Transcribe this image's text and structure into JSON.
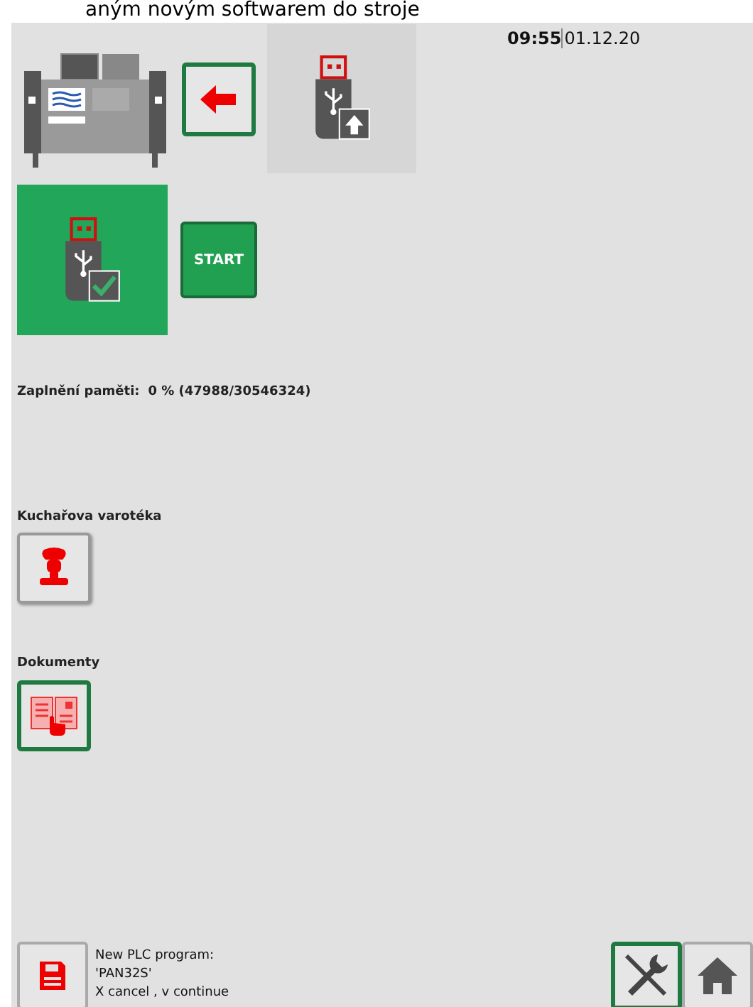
{
  "banner": "aným novým softwarem do stroje",
  "clock": {
    "time": "09:55",
    "date": "01.12.20"
  },
  "start_button": "START",
  "memory": {
    "label": "Zaplnění paměti:",
    "value": "0 % (47988/30546324)"
  },
  "sections": [
    {
      "title": "Kuchařova varotéka",
      "kind": "chef",
      "selected": false
    },
    {
      "title": "Dokumenty",
      "kind": "documents",
      "selected": true
    }
  ],
  "message": [
    "New PLC program:",
    "'PAN32S'",
    "X cancel , v continue"
  ],
  "nav": [
    {
      "kind": "tools",
      "selected": true
    },
    {
      "kind": "home",
      "selected": false
    }
  ]
}
